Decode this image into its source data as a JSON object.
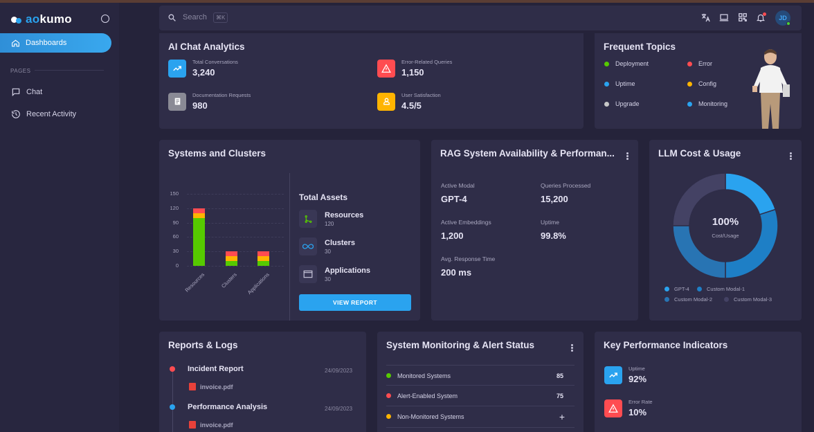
{
  "app": {
    "brand_a": "ao",
    "brand_b": "kumo"
  },
  "sidebar": {
    "active_item": "Dashboards",
    "section_label": "PAGES",
    "items": [
      {
        "label": "Chat",
        "icon": "chat-icon"
      },
      {
        "label": "Recent Activity",
        "icon": "history-icon"
      }
    ]
  },
  "topbar": {
    "search_placeholder": "Search",
    "search_shortcut": "⌘K",
    "avatar_initials": "JD"
  },
  "ai_chat": {
    "title": "AI Chat Analytics",
    "stats": [
      {
        "label": "Total Conversations",
        "value": "3,240",
        "color": "#2aa3ef",
        "icon": "trend-up-icon"
      },
      {
        "label": "Error-Related Queries",
        "value": "1,150",
        "color": "#ff4c51",
        "icon": "warning-icon"
      },
      {
        "label": "Documentation Requests",
        "value": "980",
        "color": "#8a8a95",
        "icon": "document-icon"
      },
      {
        "label": "User Satisfaction",
        "value": "4.5/5",
        "color": "#ffb400",
        "icon": "user-icon"
      }
    ]
  },
  "frequent_topics": {
    "title": "Frequent Topics",
    "topics": [
      {
        "label": "Deployment",
        "color": "#56ca00"
      },
      {
        "label": "Error",
        "color": "#ff4c51"
      },
      {
        "label": "Uptime",
        "color": "#2aa3ef"
      },
      {
        "label": "Config",
        "color": "#ffb400"
      },
      {
        "label": "Upgrade",
        "color": "#c7c7c7"
      },
      {
        "label": "Monitoring",
        "color": "#2aa3ef"
      }
    ]
  },
  "systems_clusters": {
    "title": "Systems and Clusters",
    "assets_title": "Total Assets",
    "assets": [
      {
        "name": "Resources",
        "count": "120",
        "icon": "branch-icon"
      },
      {
        "name": "Clusters",
        "count": "30",
        "icon": "infinity-icon"
      },
      {
        "name": "Applications",
        "count": "30",
        "icon": "window-icon"
      }
    ],
    "button_label": "VIEW REPORT"
  },
  "chart_data": [
    {
      "type": "bar",
      "stacked": true,
      "categories": [
        "Resources",
        "Clusters",
        "Applications"
      ],
      "yticks": [
        150,
        120,
        90,
        60,
        30,
        0
      ],
      "ylim": [
        0,
        150
      ],
      "grid": true,
      "series": [
        {
          "values": [
            100,
            10,
            10
          ],
          "color": "#56ca00"
        },
        {
          "values": [
            10,
            10,
            10
          ],
          "color": "#ffb400"
        },
        {
          "values": [
            10,
            10,
            10
          ],
          "color": "#ff4c51"
        }
      ]
    },
    {
      "type": "pie",
      "donut": true,
      "center_value": "100%",
      "center_label": "Cost/Usage",
      "labels": [
        "GPT-4",
        "Custom Modal-1",
        "Custom Modal-2",
        "Custom Modal-3"
      ],
      "values": [
        20,
        30,
        25,
        25
      ],
      "colors": [
        "#2aa3ef",
        "#1e7fc6",
        "#2874b3",
        "#444264"
      ]
    }
  ],
  "rag": {
    "title": "RAG System Availability & Performan...",
    "metrics": [
      {
        "label": "Active Modal",
        "value": "GPT-4"
      },
      {
        "label": "Queries Processed",
        "value": "15,200"
      },
      {
        "label": "Active Embeddings",
        "value": "1,200"
      },
      {
        "label": "Uptime",
        "value": "99.8%"
      },
      {
        "label": "Avg. Response Time",
        "value": "200 ms"
      }
    ]
  },
  "llm": {
    "title": "LLM Cost & Usage"
  },
  "reports": {
    "title": "Reports & Logs",
    "items": [
      {
        "title": "Incident Report",
        "date": "24/09/2023",
        "file": "invoice.pdf",
        "color": "#ff4c51"
      },
      {
        "title": "Performance Analysis",
        "date": "24/09/2023",
        "file": "invoice.pdf",
        "color": "#2aa3ef"
      }
    ]
  },
  "monitoring": {
    "title": "System Monitoring & Alert Status",
    "rows": [
      {
        "label": "Monitored Systems",
        "value": "85",
        "color": "#56ca00"
      },
      {
        "label": "Alert-Enabled System",
        "value": "75",
        "color": "#ff4c51"
      },
      {
        "label": "Non-Monitored Systems",
        "value": "+",
        "color": "#ffb400"
      }
    ]
  },
  "kpi": {
    "title": "Key Performance Indicators",
    "items": [
      {
        "label": "Uptime",
        "value": "92%",
        "color": "#2aa3ef",
        "icon": "trend-up-icon"
      },
      {
        "label": "Error Rate",
        "value": "10%",
        "color": "#ff4c51",
        "icon": "warning-icon"
      }
    ]
  }
}
